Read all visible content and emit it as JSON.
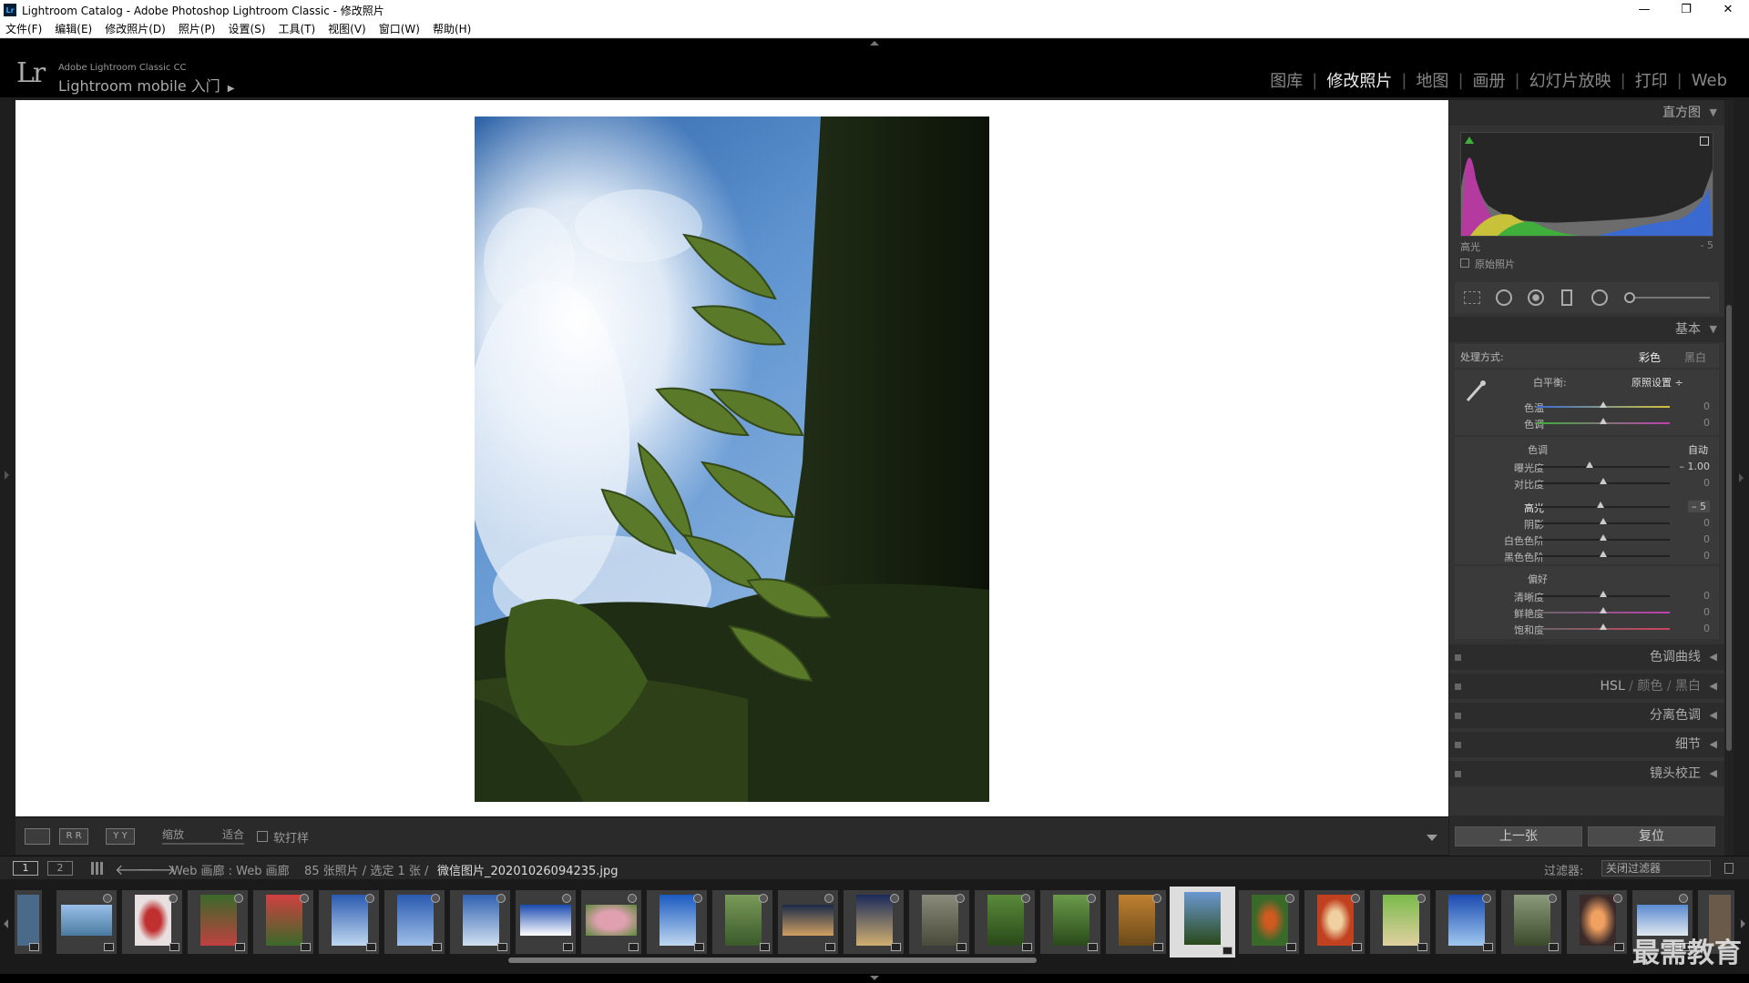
{
  "window": {
    "title": "Lightroom Catalog - Adobe Photoshop Lightroom Classic - 修改照片",
    "minimize": "—",
    "restore": "❐",
    "close": "✕"
  },
  "menu": [
    "文件(F)",
    "编辑(E)",
    "修改照片(D)",
    "照片(P)",
    "设置(S)",
    "工具(T)",
    "视图(V)",
    "窗口(W)",
    "帮助(H)"
  ],
  "identity": {
    "logo": "Lr",
    "product": "Adobe Lightroom Classic CC",
    "mobile": "Lightroom mobile 入门",
    "mobile_arrow": "▶"
  },
  "modules": [
    {
      "label": "图库",
      "active": false
    },
    {
      "label": "修改照片",
      "active": true
    },
    {
      "label": "地图",
      "active": false
    },
    {
      "label": "画册",
      "active": false
    },
    {
      "label": "幻灯片放映",
      "active": false
    },
    {
      "label": "打印",
      "active": false
    },
    {
      "label": "Web",
      "active": false
    }
  ],
  "toolbar": {
    "zoom_label": "缩放",
    "fit_label": "适合",
    "softproof_label": "软打样",
    "rr": "R R",
    "yy": "Y Y"
  },
  "histogram": {
    "title": "直方图",
    "toggle": "▼",
    "info_label": "高光",
    "info_value": "- 5",
    "original_label": "原始照片"
  },
  "basic": {
    "title": "基本",
    "toggle": "▼",
    "treatment_label": "处理方式:",
    "color": "彩色",
    "bw": "黑白",
    "wb_label": "白平衡:",
    "wb_value": "原照设置 ÷",
    "temp": {
      "label": "色温",
      "value": "0",
      "pos": 0.5
    },
    "tint": {
      "label": "色调",
      "value": "0",
      "pos": 0.5
    },
    "tone_label": "色调",
    "auto_label": "自动",
    "exposure": {
      "label": "曝光度",
      "value": "– 1.00",
      "pos": 0.4
    },
    "contrast": {
      "label": "对比度",
      "value": "0",
      "pos": 0.5
    },
    "highlights": {
      "label": "高光",
      "value": "– 5",
      "pos": 0.48
    },
    "shadows": {
      "label": "阴影",
      "value": "0",
      "pos": 0.5
    },
    "whites": {
      "label": "白色色阶",
      "value": "0",
      "pos": 0.5
    },
    "blacks": {
      "label": "黑色色阶",
      "value": "0",
      "pos": 0.5
    },
    "presence_label": "偏好",
    "clarity": {
      "label": "清晰度",
      "value": "0",
      "pos": 0.5
    },
    "vibrance": {
      "label": "鲜艳度",
      "value": "0",
      "pos": 0.5
    },
    "saturation": {
      "label": "饱和度",
      "value": "0",
      "pos": 0.5
    }
  },
  "panels": {
    "tone_curve": "色调曲线",
    "hsl_a": "HSL",
    "hsl_sep1": "/",
    "hsl_b": "颜色",
    "hsl_sep2": "/",
    "hsl_c": "黑白",
    "split_toning": "分离色调",
    "detail": "细节",
    "lens": "镜头校正",
    "collapse_arrow": "◀"
  },
  "buttons": {
    "previous": "上一张",
    "reset": "复位"
  },
  "lowbar": {
    "view1": "1",
    "view2": "2",
    "source": "Web 画廊 : Web 画廊",
    "count": "85 张照片 / 选定 1 张 /",
    "filename": "微信图片_20201026094235.jpg",
    "filter_label": "过滤器:",
    "filter_value": "关闭过滤器"
  },
  "watermark": "最需教育",
  "colors": {
    "accent": "#31a8ff",
    "panel": "#333333",
    "canvas": "#ffffff"
  }
}
